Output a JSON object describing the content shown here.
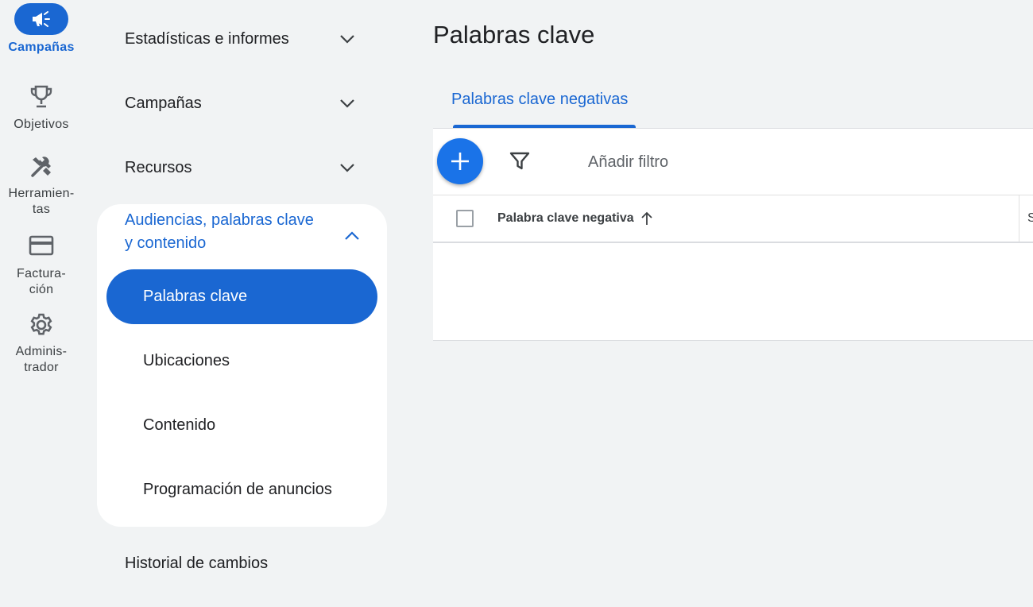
{
  "rail": {
    "items": [
      {
        "label": "Campañas",
        "icon": "megaphone-icon",
        "active": true
      },
      {
        "label": "Objetivos",
        "icon": "trophy-icon"
      },
      {
        "label": "Herramien-tas",
        "line1": "Herramien-",
        "line2": "tas",
        "icon": "tools-icon"
      },
      {
        "label": "Factura-ción",
        "line1": "Factura-",
        "line2": "ción",
        "icon": "credit-card-icon"
      },
      {
        "label": "Adminis-trador",
        "line1": "Adminis-",
        "line2": "trador",
        "icon": "gear-icon"
      }
    ]
  },
  "nav": {
    "sections": [
      {
        "label": "Estadísticas e informes"
      },
      {
        "label": "Campañas"
      },
      {
        "label": "Recursos"
      }
    ],
    "expanded": {
      "line1": "Audiencias, palabras clave",
      "line2": "y contenido",
      "items": [
        {
          "label": "Palabras clave",
          "active": true
        },
        {
          "label": "Ubicaciones"
        },
        {
          "label": "Contenido"
        },
        {
          "label": "Programación de anuncios"
        }
      ]
    },
    "footer_item": "Historial de cambios"
  },
  "main": {
    "title": "Palabras clave",
    "tab": "Palabras clave negativas",
    "add_filter": "Añadir filtro",
    "column_header": "Palabra clave negativa",
    "next_column_partial": "S"
  },
  "colors": {
    "accent": "#1a67d2",
    "background": "#f1f3f4"
  }
}
